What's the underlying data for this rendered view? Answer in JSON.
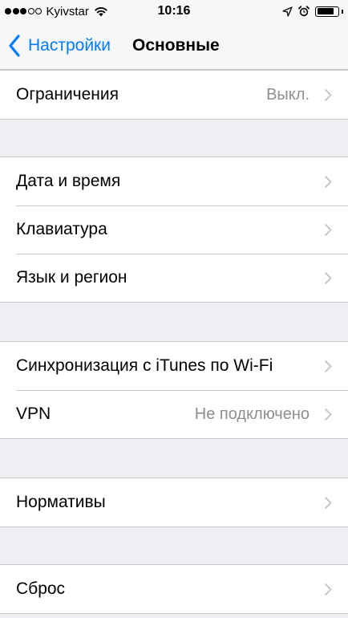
{
  "status_bar": {
    "carrier": "Kyivstar",
    "time": "10:16",
    "battery_level": 0.85
  },
  "nav": {
    "back_label": "Настройки",
    "title": "Основные"
  },
  "groups": [
    {
      "items": [
        {
          "label": "Ограничения",
          "value": "Выкл."
        }
      ]
    },
    {
      "items": [
        {
          "label": "Дата и время"
        },
        {
          "label": "Клавиатура"
        },
        {
          "label": "Язык и регион"
        }
      ]
    },
    {
      "items": [
        {
          "label": "Синхронизация с iTunes по Wi-Fi"
        },
        {
          "label": "VPN",
          "value": "Не подключено"
        }
      ]
    },
    {
      "items": [
        {
          "label": "Нормативы"
        }
      ]
    },
    {
      "items": [
        {
          "label": "Сброс"
        }
      ]
    }
  ],
  "colors": {
    "accent": "#007aff",
    "background": "#efeff4",
    "separator": "#c8c7cc",
    "secondary_text": "#8e8e93",
    "chevron": "#c7c7cc"
  }
}
